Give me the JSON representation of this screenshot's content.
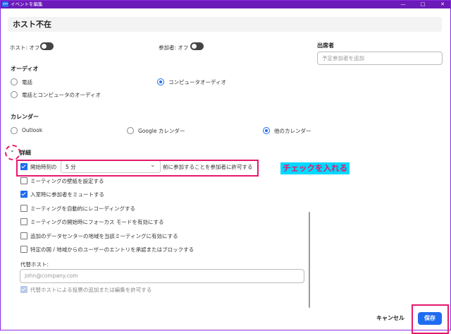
{
  "window": {
    "app_icon": "zm",
    "title": "イベントを編集",
    "controls": [
      "minimize-icon",
      "maximize-icon",
      "close-icon"
    ]
  },
  "topic": "ホスト不在",
  "video": {
    "host_label": "ホスト: オフ",
    "participant_label": "参加者: オフ"
  },
  "attendees": {
    "label": "出席者",
    "placeholder": "予定参加者を追加"
  },
  "audio": {
    "label": "オーディオ",
    "options": [
      "電話",
      "コンピュータオーディオ",
      "電話とコンピュータのオーディオ"
    ],
    "selected": "コンピュータオーディオ"
  },
  "calendar": {
    "label": "カレンダー",
    "options": [
      "Outlook",
      "Google カレンダー",
      "他のカレンダー"
    ],
    "selected": "他のカレンダー"
  },
  "details": {
    "label": "詳細",
    "join_before": {
      "prefix": "開始時刻の",
      "value": "5 分",
      "suffix": "前に参加することを参加者に許可する",
      "checked": true
    },
    "options": [
      {
        "label": "ミーティングの壁紙を設定する",
        "checked": false
      },
      {
        "label": "入室時に参加者をミュートする",
        "checked": true
      },
      {
        "label": "ミーティングを自動的にレコーディングする",
        "checked": false
      },
      {
        "label": "ミーティングの開始時にフォーカス モードを有効にする",
        "checked": false
      },
      {
        "label": "追加のデータセンターの地域を当該ミーティングに有効にする",
        "checked": false
      },
      {
        "label": "特定の国 / 地域からのユーザーのエントリを承認またはブロックする",
        "checked": false
      }
    ],
    "alt_host_label": "代替ホスト:",
    "alt_host_placeholder": "john@company.com",
    "alt_host_permission": "代替ホストによる投票の追加または編集を許可する"
  },
  "annotation": "チェックを入れる",
  "footer": {
    "cancel": "キャンセル",
    "save": "保存"
  },
  "colors": {
    "titlebar": "#6a1bb8",
    "accent": "#1f6cf0",
    "highlight": "#e5196e",
    "annotation_bg": "#00d8ff"
  }
}
